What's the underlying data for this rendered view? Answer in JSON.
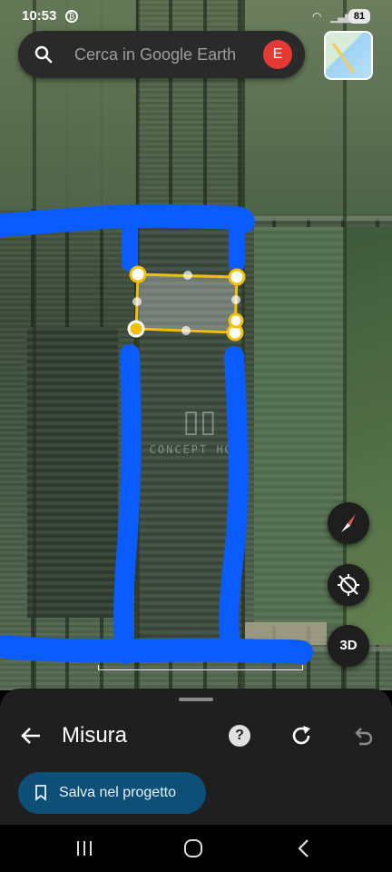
{
  "status_bar": {
    "time": "10:53",
    "battery": "81"
  },
  "search": {
    "placeholder": "Cerca in Google Earth",
    "avatar_letter": "E"
  },
  "map": {
    "watermark": "CONCEPT HOME",
    "button_3d": "3D"
  },
  "panel": {
    "title": "Misura",
    "help": "?",
    "save_label": "Salva nel progetto"
  },
  "colors": {
    "accent_blue": "#0b5cff",
    "selection": "#f2c000",
    "save_bg": "#0e4f78",
    "avatar": "#e53935"
  },
  "icons": [
    "search-icon",
    "minimap-thumbnail",
    "compass-icon",
    "location-disabled-icon",
    "back-arrow-icon",
    "help-icon",
    "reload-icon",
    "undo-icon",
    "bookmark-icon",
    "recent-apps-icon",
    "home-icon",
    "back-nav-icon"
  ]
}
